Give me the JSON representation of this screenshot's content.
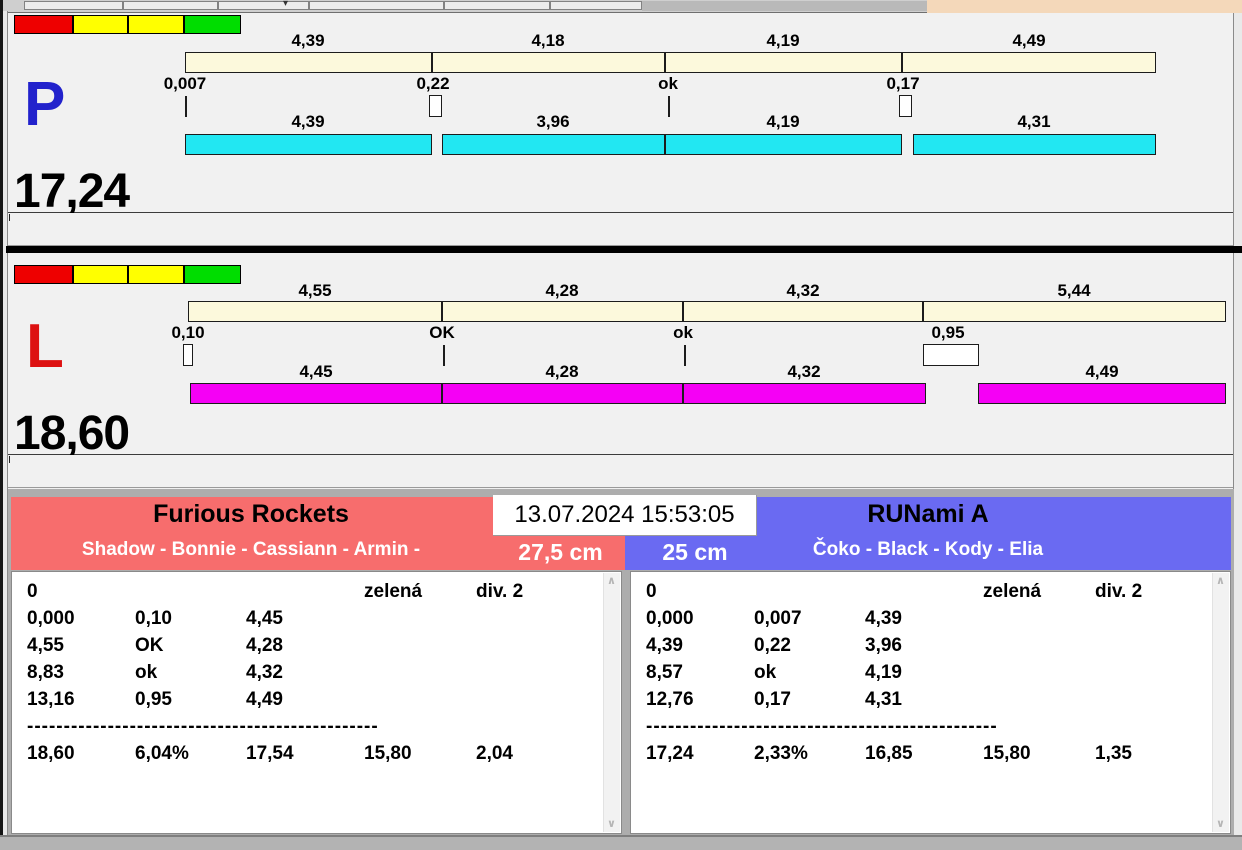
{
  "colors": {
    "swatches": [
      "#ee0000",
      "#ffff00",
      "#ffff00",
      "#00dd00"
    ],
    "split_bar": "#fcf9dc",
    "lane_p_bar": "#22e7f2",
    "lane_l_bar": "#f500f5",
    "lane_p_label": "#2222cc",
    "lane_l_label": "#dd1111",
    "team_left": "#f76d6d",
    "team_right": "#6a6af2"
  },
  "timestamp": "13.07.2024 15:53:05",
  "lanes": [
    {
      "label": "P",
      "total": "17,24",
      "splits": [
        "4,39",
        "4,18",
        "4,19",
        "4,49"
      ],
      "exchanges": [
        "0,007",
        "0,22",
        "ok",
        "0,17"
      ],
      "runs": [
        "4,39",
        "3,96",
        "4,19",
        "4,31"
      ]
    },
    {
      "label": "L",
      "total": "18,60",
      "splits": [
        "4,55",
        "4,28",
        "4,32",
        "5,44"
      ],
      "exchanges": [
        "0,10",
        "OK",
        "ok",
        "0,95"
      ],
      "runs": [
        "4,45",
        "4,28",
        "4,32",
        "4,49"
      ]
    }
  ],
  "teams": [
    {
      "name": "Furious Rockets",
      "members": "Shadow - Bonnie - Cassiann - Armin -",
      "height": "27,5 cm",
      "table": {
        "faults": "0",
        "category": "zelená",
        "division": "div. 2",
        "rows": [
          [
            "0,000",
            "0,10",
            "4,45"
          ],
          [
            "4,55",
            "OK",
            "4,28"
          ],
          [
            "8,83",
            "ok",
            "4,32"
          ],
          [
            "13,16",
            "0,95",
            "4,49"
          ]
        ],
        "separator": "------------------------------------------------",
        "summary": [
          "18,60",
          "6,04%",
          "17,54",
          "15,80",
          "2,04"
        ]
      }
    },
    {
      "name": "RUNami A",
      "members": "Čoko - Black - Kody - Elia",
      "height": "25 cm",
      "table": {
        "faults": "0",
        "category": "zelená",
        "division": "div. 2",
        "rows": [
          [
            "0,000",
            "0,007",
            "4,39"
          ],
          [
            "4,39",
            "0,22",
            "3,96"
          ],
          [
            "8,57",
            "ok",
            "4,19"
          ],
          [
            "12,76",
            "0,17",
            "4,31"
          ]
        ],
        "separator": "------------------------------------------------",
        "summary": [
          "17,24",
          "2,33%",
          "16,85",
          "15,80",
          "1,35"
        ]
      }
    }
  ]
}
